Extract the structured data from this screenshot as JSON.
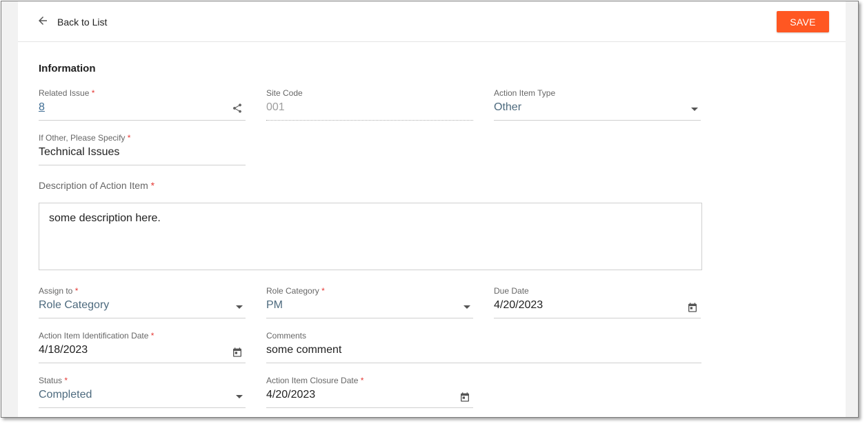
{
  "header": {
    "back_label": "Back to List",
    "save_label": "SAVE",
    "save_color": "#ff5722"
  },
  "section": {
    "title": "Information"
  },
  "fields": {
    "related_issue": {
      "label": "Related Issue",
      "value": "8",
      "required_mark": "*",
      "icon": "share-icon"
    },
    "site_code": {
      "label": "Site Code",
      "value": "001"
    },
    "action_item_type": {
      "label": "Action Item Type",
      "value": "Other",
      "icon": "dropdown-caret"
    },
    "if_other": {
      "label": "If Other, Please Specify",
      "value": "Technical Issues",
      "required_mark": "*"
    },
    "description": {
      "label": "Description of Action Item",
      "value": "some description here.",
      "required_mark": "*"
    },
    "assign_to": {
      "label": "Assign to",
      "value": "Role Category",
      "required_mark": "*",
      "icon": "dropdown-caret"
    },
    "role_category": {
      "label": "Role Category",
      "value": "PM",
      "required_mark": "*",
      "icon": "dropdown-caret"
    },
    "due_date": {
      "label": "Due Date",
      "value": "4/20/2023",
      "icon": "calendar-icon"
    },
    "identification_date": {
      "label": "Action Item Identification Date",
      "value": "4/18/2023",
      "required_mark": "*",
      "icon": "calendar-icon"
    },
    "comments": {
      "label": "Comments",
      "value": "some comment"
    },
    "status": {
      "label": "Status",
      "value": "Completed",
      "required_mark": "*",
      "icon": "dropdown-caret"
    },
    "closure_date": {
      "label": "Action Item Closure Date",
      "value": "4/20/2023",
      "required_mark": "*",
      "icon": "calendar-icon"
    }
  }
}
